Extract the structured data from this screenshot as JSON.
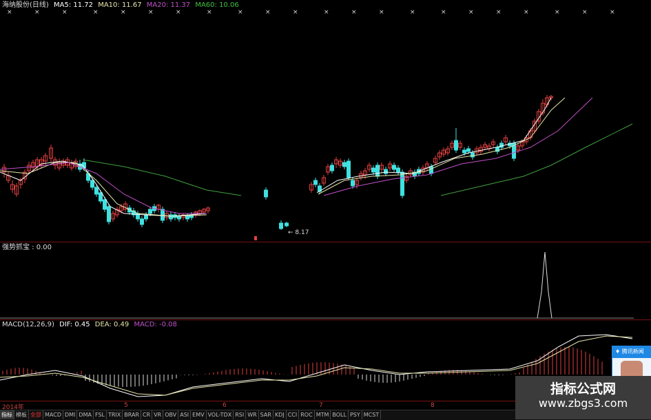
{
  "main": {
    "title": "海纳股份(日线)",
    "ma5": "MA5: 11.72",
    "ma10": "MA10: 11.67",
    "ma20": "MA20: 11.37",
    "ma60": "MA60: 10.06",
    "low_price": "8.17"
  },
  "indicator": {
    "label": "强势抓宝 : 0.00"
  },
  "macd": {
    "name": "MACD(12,26,9)",
    "dif": "DIF: 0.45",
    "dea": "DEA: 0.49",
    "macd": "MACD: -0.08"
  },
  "xaxis": {
    "labels": [
      "2014年",
      "5",
      "6",
      "7",
      "8"
    ]
  },
  "tabs": [
    "指标",
    "模板",
    "全部",
    "MACD",
    "DMI",
    "DMA",
    "FSL",
    "TRIX",
    "BRAR",
    "CR",
    "VR",
    "OBV",
    "ASI",
    "EMV",
    "VOL-TDX",
    "RSI",
    "WR",
    "SAR",
    "KDJ",
    "CCI",
    "ROC",
    "MTM",
    "BOLL",
    "PSY",
    "MCST"
  ],
  "qq": {
    "title": "腾讯新闻"
  },
  "brand": {
    "line1": "指标公式网",
    "line2": "www.zbgs3.com"
  },
  "colors": {
    "ma5": "#ffffff",
    "ma10": "#e6e6aa",
    "ma20": "#c050c8",
    "ma60": "#40a040",
    "up": "#e04040",
    "down": "#40e0e0"
  }
}
